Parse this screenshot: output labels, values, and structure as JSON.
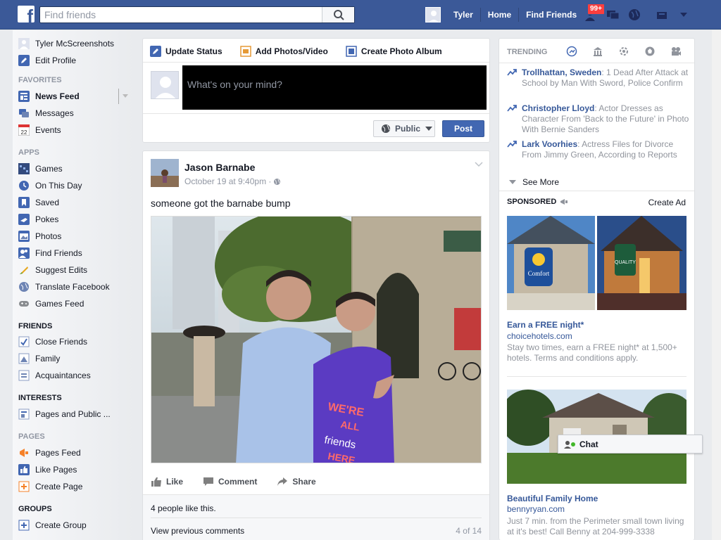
{
  "topbar": {
    "logo": "f",
    "search_placeholder": "Find friends",
    "user_name": "Tyler",
    "nav_home": "Home",
    "nav_find_friends": "Find Friends",
    "notif_badge": "99+",
    "brand_color": "#3b5998"
  },
  "sidebar": {
    "profile_name": "Tyler McScreenshots",
    "edit_profile": "Edit Profile",
    "favorites_header": "FAVORITES",
    "news_feed": "News Feed",
    "messages": "Messages",
    "events": "Events",
    "events_icon_day": "22",
    "apps_header": "APPS",
    "apps": [
      "Games",
      "On This Day",
      "Saved",
      "Pokes",
      "Photos",
      "Find Friends",
      "Suggest Edits",
      "Translate Facebook",
      "Games Feed"
    ],
    "friends_header": "FRIENDS",
    "friends": [
      "Close Friends",
      "Family",
      "Acquaintances"
    ],
    "interests_header": "INTERESTS",
    "interests": [
      "Pages and Public ..."
    ],
    "pages_header": "PAGES",
    "pages": [
      "Pages Feed",
      "Like Pages",
      "Create Page"
    ],
    "groups_header": "GROUPS",
    "groups": [
      "Create Group"
    ]
  },
  "composer": {
    "tab_update_status": "Update Status",
    "tab_add_photos": "Add Photos/Video",
    "tab_create_album": "Create Photo Album",
    "placeholder": "What's on your mind?",
    "privacy": "Public",
    "post_button": "Post"
  },
  "post": {
    "author": "Jason Barnabe",
    "timestamp": "October 19 at 9:40pm · ",
    "text": "someone got the barnabe bump",
    "action_like": "Like",
    "action_comment": "Comment",
    "action_share": "Share",
    "likes_summary": "4 people like this.",
    "view_previous": "View previous comments",
    "comment_count": "4 of 14"
  },
  "right": {
    "trending_header": "TRENDING",
    "trending": [
      {
        "name": "Trollhattan, Sweden",
        "desc": ": 1 Dead After Attack at School by Man With Sword, Police Confirm"
      },
      {
        "name": "Christopher Lloyd",
        "desc": ": Actor Dresses as Character From 'Back to the Future' in Photo With Bernie Sanders"
      },
      {
        "name": "Lark Voorhies",
        "desc": ": Actress Files for Divorce From Jimmy Green, According to Reports"
      }
    ],
    "see_more": "See More",
    "sponsored_header": "SPONSORED",
    "create_ad": "Create Ad",
    "ad1": {
      "sign_left": "Comfort",
      "sign_right": "QUALITY",
      "title": "Earn a FREE night*",
      "url": "choicehotels.com",
      "desc": "Stay two times, earn a FREE night* at 1,500+ hotels. Terms and conditions apply."
    },
    "ad2": {
      "title": "Beautiful Family Home",
      "url": "bennyryan.com",
      "desc": "Just 7 min. from the Perimeter small town living at it's best! Call Benny at 204-999-3338"
    }
  },
  "chat": {
    "label": "Chat"
  }
}
